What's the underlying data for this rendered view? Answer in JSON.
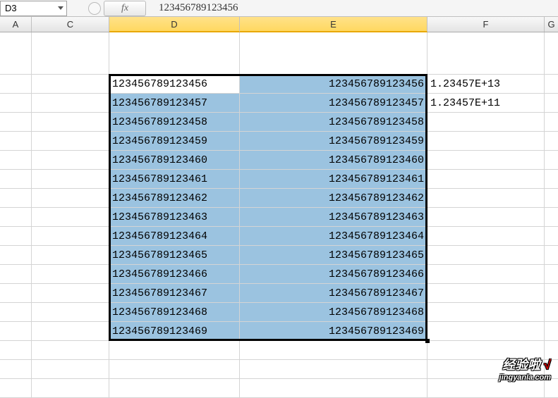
{
  "name_box": "D3",
  "fx_label": "fx",
  "formula_value": "123456789123456",
  "columns": [
    "A",
    "C",
    "D",
    "E",
    "F",
    "G"
  ],
  "selected_columns": [
    "D",
    "E"
  ],
  "rows": [
    {
      "D": "123456789123456",
      "E": "123456789123456",
      "F": "1.23457E+13"
    },
    {
      "D": "123456789123457",
      "E": "123456789123457",
      "F": "1.23457E+11"
    },
    {
      "D": "123456789123458",
      "E": "123456789123458",
      "F": ""
    },
    {
      "D": "123456789123459",
      "E": "123456789123459",
      "F": ""
    },
    {
      "D": "123456789123460",
      "E": "123456789123460",
      "F": ""
    },
    {
      "D": "123456789123461",
      "E": "123456789123461",
      "F": ""
    },
    {
      "D": "123456789123462",
      "E": "123456789123462",
      "F": ""
    },
    {
      "D": "123456789123463",
      "E": "123456789123463",
      "F": ""
    },
    {
      "D": "123456789123464",
      "E": "123456789123464",
      "F": ""
    },
    {
      "D": "123456789123465",
      "E": "123456789123465",
      "F": ""
    },
    {
      "D": "123456789123466",
      "E": "123456789123466",
      "F": ""
    },
    {
      "D": "123456789123467",
      "E": "123456789123467",
      "F": ""
    },
    {
      "D": "123456789123468",
      "E": "123456789123468",
      "F": ""
    },
    {
      "D": "123456789123469",
      "E": "123456789123469",
      "F": ""
    }
  ],
  "watermark": {
    "top": "经验啦",
    "check": "√",
    "bottom": "jingyanla.com"
  }
}
